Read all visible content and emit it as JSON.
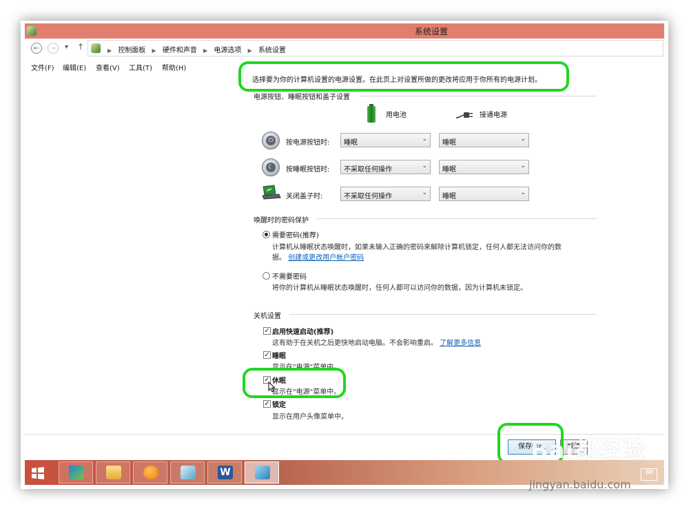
{
  "window": {
    "title": "系统设置"
  },
  "address": {
    "back_glyph": "←",
    "forward_glyph": "→",
    "dropdown_glyph": "▾",
    "up_glyph": "↑",
    "breadcrumbs": [
      "控制面板",
      "硬件和声音",
      "电源选项",
      "系统设置"
    ]
  },
  "menu": [
    "文件(F)",
    "编辑(E)",
    "查看(V)",
    "工具(T)",
    "帮助(H)"
  ],
  "main": {
    "info": "选择要为你的计算机设置的电源设置。在此页上对设置所做的更改将应用于你所有的电源计划。",
    "power_group": {
      "label": "电源按钮、睡眠按钮和盖子设置",
      "col_battery": "用电池",
      "col_plugged": "接通电源",
      "rows": [
        {
          "label": "按电源按钮时:",
          "battery": "睡眠",
          "plugged": "睡眠",
          "icon": "power-button-icon"
        },
        {
          "label": "按睡眠按钮时:",
          "battery": "不采取任何操作",
          "plugged": "睡眠",
          "icon": "sleep-button-icon"
        },
        {
          "label": "关闭盖子时:",
          "battery": "不采取任何操作",
          "plugged": "睡眠",
          "icon": "laptop-lid-icon"
        }
      ]
    },
    "password_group": {
      "label": "唤醒时的密码保护",
      "require": {
        "label": "需要密码(推荐)",
        "desc1": "计算机从睡眠状态唤醒时，如果未输入正确的密码来解除计算机锁定，任何人都无法访问你的数",
        "desc2_prefix": "据。",
        "link": "创建或更改用户帐户密码",
        "selected": true
      },
      "no_require": {
        "label": "不需要密码",
        "desc": "将你的计算机从睡眠状态唤醒时，任何人都可以访问你的数据，因为计算机未锁定。",
        "selected": false
      }
    },
    "shutdown_group": {
      "label": "关机设置",
      "items": [
        {
          "label": "启用快速启动(推荐)",
          "desc": "这有助于在关机之后更快地启动电脑。不会影响重启。",
          "link": "了解更多信息",
          "checked": true
        },
        {
          "label": "睡眠",
          "desc": "显示在\"电源\"菜单中。",
          "checked": true
        },
        {
          "label": "休眠",
          "desc": "显示在\"电源\"菜单中。",
          "checked": true
        },
        {
          "label": "锁定",
          "desc": "显示在用户头像菜单中。",
          "checked": true
        }
      ]
    }
  },
  "buttons": {
    "save": "保存修改",
    "cancel": "取消"
  },
  "check_glyph": "✓",
  "taskbar": {
    "items": [
      "lenovo-tool-icon",
      "file-explorer-icon",
      "orange-app-icon",
      "notebook-icon",
      "word-icon",
      "control-panel-icon"
    ],
    "keyboard_glyph": "⌨"
  },
  "watermark": {
    "main": "Bai都经验",
    "sub": "jingyan.baidu.com"
  },
  "colors": {
    "titlebar": "#e07e70",
    "highlight": "#1ed81e",
    "link": "#0f5fb8"
  }
}
